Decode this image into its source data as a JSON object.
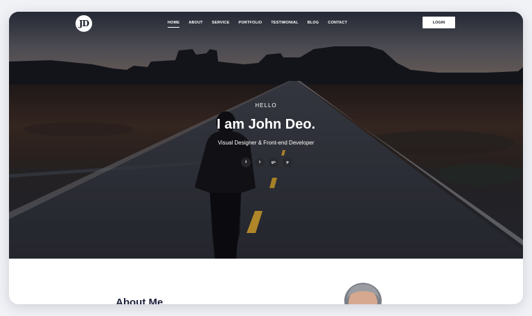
{
  "brand": {
    "logo_text": "JD"
  },
  "nav": {
    "items": [
      "HOME",
      "ABOUT",
      "SERVICE",
      "PORTFOLIO",
      "TESTIMONIAL",
      "BLOG",
      "CONTACT"
    ],
    "active": "HOME",
    "login_label": "LOGIN"
  },
  "hero": {
    "greeting": "HELLO",
    "title": "I am John Deo.",
    "subtitle": "Visual Designer & Front-end Developer",
    "socials": [
      {
        "icon": "facebook-icon",
        "glyph": "f"
      },
      {
        "icon": "twitter-icon",
        "glyph": "t"
      },
      {
        "icon": "google-plus-icon",
        "glyph": "g+"
      },
      {
        "icon": "pinterest-icon",
        "glyph": "p"
      }
    ]
  },
  "about": {
    "title": "About Me"
  },
  "colors": {
    "text_light": "#ffffff",
    "dark_text": "#1b1e3a",
    "page_bg": "#f1f2f6"
  }
}
